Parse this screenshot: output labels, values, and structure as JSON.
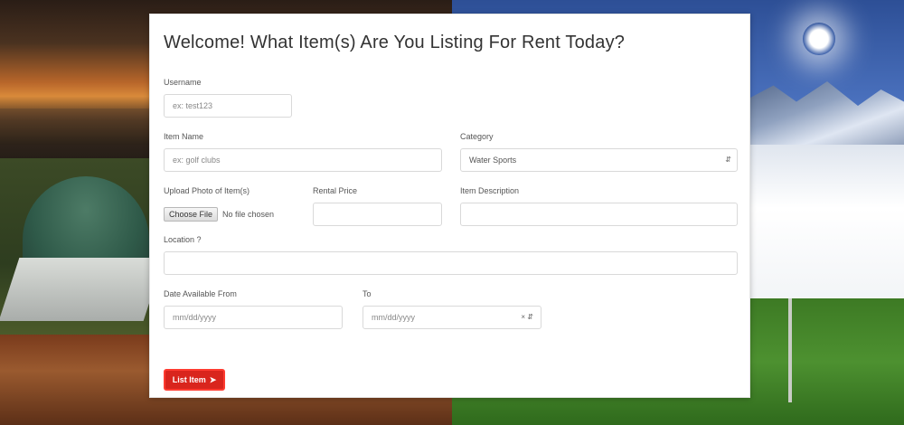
{
  "form": {
    "title": "Welcome! What Item(s) Are You Listing For Rent Today?",
    "username": {
      "label": "Username",
      "placeholder": "ex: test123"
    },
    "item_name": {
      "label": "Item Name",
      "placeholder": "ex: golf clubs"
    },
    "category": {
      "label": "Category",
      "value": "Water Sports"
    },
    "upload": {
      "label": "Upload Photo of Item(s)",
      "button": "Choose File",
      "status": "No file chosen"
    },
    "rental_price": {
      "label": "Rental Price",
      "value": ""
    },
    "item_description": {
      "label": "Item Description",
      "value": ""
    },
    "location": {
      "label": "Location ?",
      "value": ""
    },
    "date_from": {
      "label": "Date Available From",
      "placeholder": "mm/dd/yyyy"
    },
    "date_to": {
      "label": "To",
      "placeholder": "mm/dd/yyyy"
    },
    "submit_label": "List Item",
    "submit_icon": "arrow-right-icon"
  },
  "colors": {
    "accent": "#d9251d",
    "card_bg": "#ffffff"
  }
}
